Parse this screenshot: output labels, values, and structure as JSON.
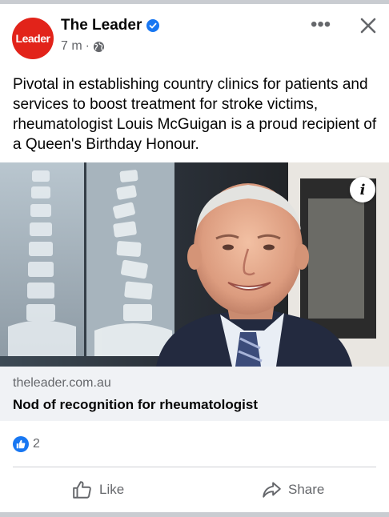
{
  "post": {
    "author": "The Leader",
    "avatar_text": "Leader",
    "time": "7 m",
    "separator": "·",
    "text": "Pivotal in establishing country clinics for patients and services to boost treatment for stroke victims, rheumatologist Louis McGuigan is a proud recipient of a Queen's Birthday Honour."
  },
  "link": {
    "domain": "theleader.com.au",
    "headline": "Nod of recognition for rheumatologist"
  },
  "reactions": {
    "count": "2"
  },
  "actions": {
    "like": "Like",
    "share": "Share"
  },
  "icons": {
    "more": "more-options-icon",
    "close": "close-icon",
    "globe": "globe-icon",
    "info": "info-icon",
    "verified": "verified-badge-icon"
  },
  "colors": {
    "brand_red": "#e2231a",
    "facebook_blue": "#1877f2",
    "secondary_text": "#65676b"
  }
}
